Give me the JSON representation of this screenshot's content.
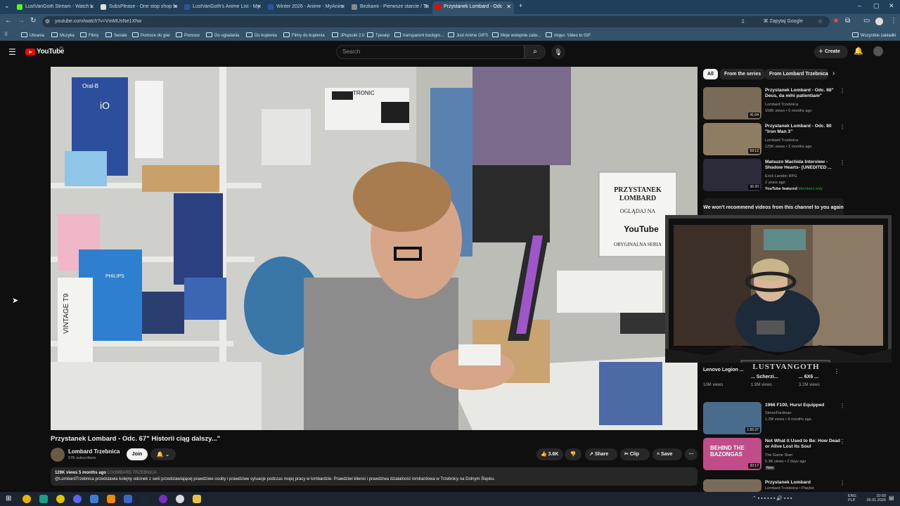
{
  "browser": {
    "tabs": [
      {
        "label": "LustVanGoth Stream - Watch L",
        "fav_color": "#53fc18"
      },
      {
        "label": "SubsPlease - One stop shop fo",
        "fav_color": "#e0e0e0"
      },
      {
        "label": "LustVanGoth's Anime List - My",
        "fav_color": "#2e51a2"
      },
      {
        "label": "Winter 2026 - Anime - MyAnim",
        "fav_color": "#2e51a2"
      },
      {
        "label": "Bezkami - Pierwsze starcie / Th",
        "fav_color": "#8a8a8a"
      },
      {
        "label": "Przystanek Lombard - Odc",
        "fav_color": "#ff0000"
      }
    ],
    "new_tab": "+",
    "url": "youtube.com/watch?v=VmMUsNe1Xhw",
    "translate_label": "Zapytaj Google",
    "bookmarks": [
      "Ubrania",
      "Muzyka",
      "Filmy",
      "Seriale",
      "Pomoce do gier",
      "Pomoce",
      "Do ogladania",
      "Do kupienia",
      "Filmy do kupienia",
      "JPopsuki 2.0",
      "Tpeakp",
      "transparent backgro...",
      "Just Anime GIFS",
      "Moje wstepnie zatw...",
      "Imgur: Video to GIF"
    ],
    "all_bookmarks": "Wszystkie zakładki"
  },
  "youtube": {
    "logo": "YouTube",
    "country": "PL",
    "search_placeholder": "Search",
    "create_label": "Create"
  },
  "video": {
    "title": "Przystanek Lombard - Odc. 67\" Historii ciąg dalszy...\"",
    "channel": "Lombard Trzebnica",
    "subscribers": "57K subscribers",
    "join_label": "Join",
    "likes": "3.6K",
    "share_label": "Share",
    "clip_label": "Clip",
    "save_label": "Save",
    "stats": "129K views  5 months ago",
    "stats_tag": "LOOMBARD TRZEBNICA",
    "description": "@LombardTrzebnica przedstawia kolejny odcinek z serii przedstawiającej prawdziwe osoby i prawdziwe sytuacje podczas mojej pracy w lombardzie. Prawdziwi klienci i prawdziwa działalność lombardowa w Trzebnicy na Dolnym Śląsku.",
    "scene_sign": [
      "PRZYSTANEK",
      "LOMBARD",
      "OGLĄDAJ NA",
      "YouTube",
      "ORYGINALNA SERIA"
    ],
    "scene_box_labels": [
      "Oral-B",
      "iO",
      "TRONIC",
      "VINTAGE T9",
      "PHILIPS"
    ]
  },
  "sidebar": {
    "chips": [
      "All",
      "From the series",
      "From Lombard Trzebnica"
    ],
    "recommendations": [
      {
        "title": "Przystanek Lombard - Odc. 68\" Deus, da mihi patientiam\"",
        "channel": "Lombard Trzebnica",
        "views": "158K views • 5 months ago",
        "duration": "41:04",
        "thumb": "#7a6a58"
      },
      {
        "title": "Przystanek Lombard - Odc. 80 \"Iron Man 3\"",
        "channel": "Lombard Trzebnica",
        "views": "125K views • 2 months ago",
        "duration": "59:12",
        "thumb": "#8f7d63"
      },
      {
        "title": "Matsuzo Machida Interview - Shadow Hearts- (UNEDITED ...",
        "channel": "Erick Landon RPG",
        "views": "2 years ago",
        "duration": "36:20",
        "badge": "YouTube featured",
        "members": "Members only",
        "thumb": "#2b2b3a"
      }
    ],
    "no_recommend": "We won't recommend videos from this channel to you again",
    "shorts": [
      {
        "title": "Lenovo Legion ...",
        "views": "10M views"
      },
      {
        "title": "... Scherzi...",
        "views": "1.9M views"
      },
      {
        "title": "... 6X6 ...",
        "views": "3.2M views"
      }
    ],
    "more": [
      {
        "title": "1966 F100, Hurst Equipped",
        "channel": "SimonFordman",
        "views": "1.2M views • 9 months ago",
        "duration": "1:56:37",
        "thumb": "#4a6c8c"
      },
      {
        "title": "Not What it Used to Be: How Dead or Alive Lost Its Soul",
        "channel": "The Game Stan",
        "views": "5.3K views • 2 days ago",
        "duration": "20:17",
        "badge": "New",
        "thumb_text": "BEHIND THE BAZONGAS",
        "thumb": "#c04d8a"
      },
      {
        "title": "Przystanek Lombard",
        "channel": "Lombard Trzebnica • Playlist",
        "views": "",
        "duration": "",
        "thumb": "#7a6a58"
      }
    ]
  },
  "overlay": {
    "streamer_logo": "LUSTVANGOTH"
  },
  "taskbar": {
    "lang": "ENG",
    "lang2": "PLP",
    "time": "10:50",
    "date": "05.01.2026"
  }
}
